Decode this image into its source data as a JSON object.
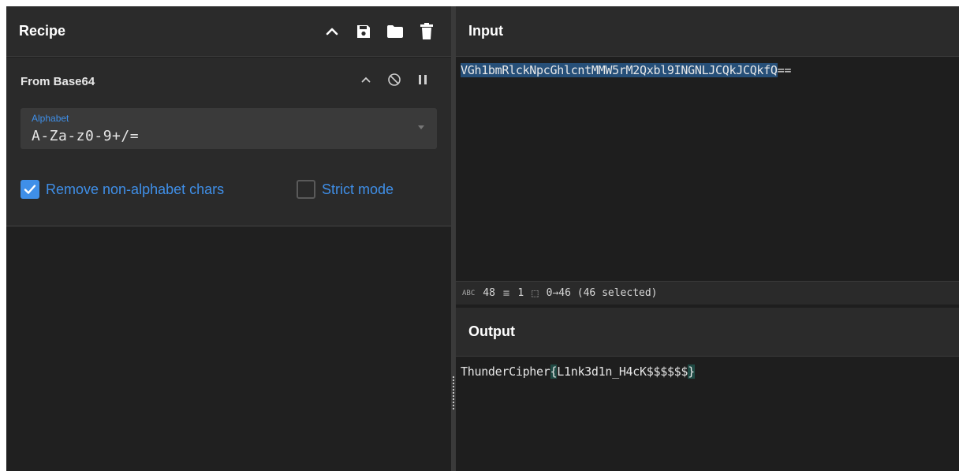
{
  "recipe": {
    "title": "Recipe",
    "icons": [
      "chevron-up-icon",
      "save-icon",
      "folder-icon",
      "trash-icon"
    ]
  },
  "operation": {
    "title": "From Base64",
    "alphabet_label": "Alphabet",
    "alphabet_value": "A-Za-z0-9+/=",
    "remove_non_alphabet_label": "Remove non-alphabet chars",
    "remove_non_alphabet_checked": true,
    "strict_mode_label": "Strict mode",
    "strict_mode_checked": false
  },
  "input": {
    "title": "Input",
    "text_selected": "VGh1bmRlckNpcGhlcntMMW5rM2Qxbl9INGNLJCQkJCQkfQ",
    "text_rest": "==",
    "status": {
      "length": "48",
      "lines": "1",
      "selection": "0→46 (46 selected)"
    }
  },
  "output": {
    "title": "Output",
    "prefix": "ThunderCipher",
    "open_brace": "{",
    "inner": "L1nk3d1n_H4cK$$$$$$",
    "close_brace": "}"
  },
  "colors": {
    "accent": "#3f8fe8",
    "selection": "#264f78",
    "brace_highlight": "#1f4a44"
  }
}
